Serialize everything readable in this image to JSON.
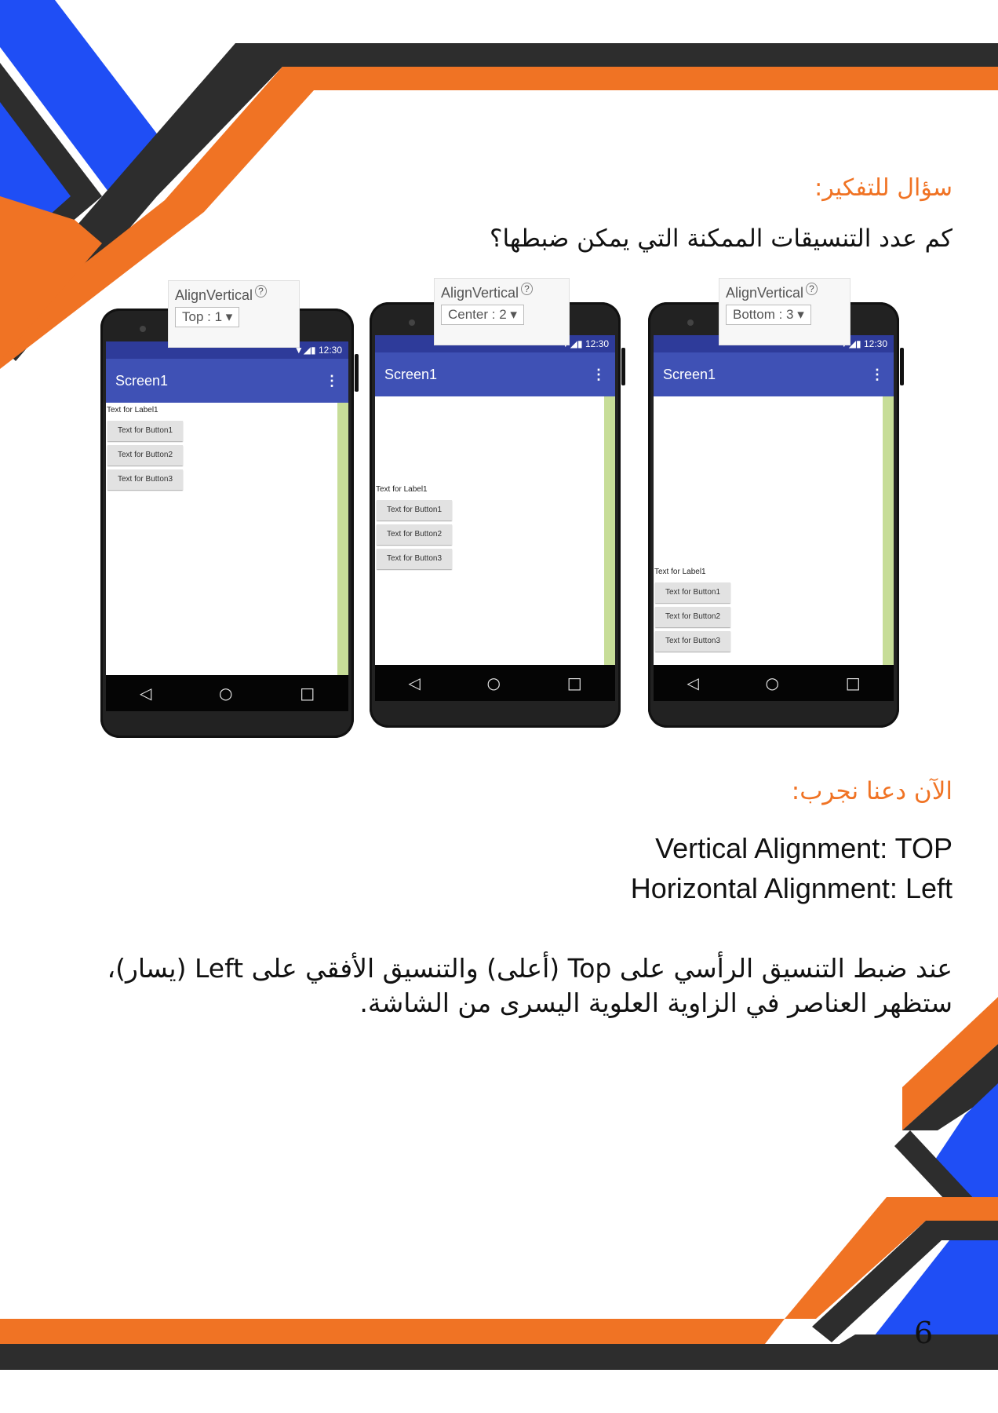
{
  "think_title": "سؤال للتفكير:",
  "question": "كم عدد التنسيقات الممكنة التي يمكن ضبطها؟",
  "try_title": "الآن دعنا نجرب:",
  "vertical_alignment": "Vertical Alignment: TOP",
  "horizontal_alignment": "Horizontal Alignment: Left",
  "explanation": "عند ضبط التنسيق الرأسي على Top (أعلى) والتنسيق الأفقي على Left (يسار)، ستظهر العناصر في الزاوية العلوية اليسرى من الشاشة.",
  "page_number": "6",
  "phones": [
    {
      "property_title": "AlignVertical",
      "help_icon": "?",
      "property_value": "Top : 1 ▾",
      "status_time": "12:30",
      "status_icons": "▼◢▮",
      "screen_title": "Screen1",
      "menu_icon": "⋮",
      "label": "Text for Label1",
      "buttons": [
        "Text for Button1",
        "Text for Button2",
        "Text for Button3"
      ],
      "nav": {
        "back": "◁",
        "home": "○",
        "recent": "□"
      }
    },
    {
      "property_title": "AlignVertical",
      "help_icon": "?",
      "property_value": "Center : 2 ▾",
      "status_time": "12:30",
      "status_icons": "▼◢▮",
      "screen_title": "Screen1",
      "menu_icon": "⋮",
      "label": "Text for Label1",
      "buttons": [
        "Text for Button1",
        "Text for Button2",
        "Text for Button3"
      ],
      "nav": {
        "back": "◁",
        "home": "○",
        "recent": "□"
      }
    },
    {
      "property_title": "AlignVertical",
      "help_icon": "?",
      "property_value": "Bottom : 3 ▾",
      "status_time": "12:30",
      "status_icons": "▼◢▮",
      "screen_title": "Screen1",
      "menu_icon": "⋮",
      "label": "Text for Label1",
      "buttons": [
        "Text for Button1",
        "Text for Button2",
        "Text for Button3"
      ],
      "nav": {
        "back": "◁",
        "home": "○",
        "recent": "□"
      }
    }
  ],
  "colors": {
    "orange": "#f07324",
    "blue": "#1f4ef5",
    "dark": "#2d2d2d",
    "appbar": "#3f51b5"
  }
}
